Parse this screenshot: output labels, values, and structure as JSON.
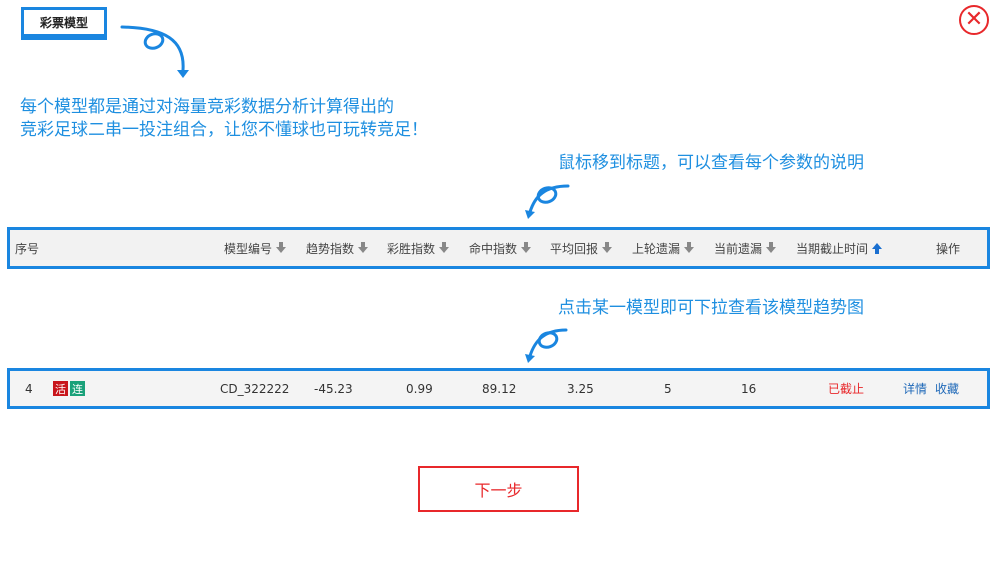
{
  "tag": {
    "label": "彩票模型"
  },
  "hints": {
    "intro_line1": "每个模型都是通过对海量竞彩数据分析计算得出的",
    "intro_line2": "竞彩足球二串一投注组合，让您不懂球也可玩转竞足！",
    "header_tip": "鼠标移到标题，可以查看每个参数的说明",
    "row_tip": "点击某一模型即可下拉查看该模型趋势图"
  },
  "table": {
    "headers": {
      "index": "序号",
      "model_no": "模型编号",
      "trend": "趋势指数",
      "win": "彩胜指数",
      "hit": "命中指数",
      "avg_return": "平均回报",
      "last_miss": "上轮遗漏",
      "cur_miss": "当前遗漏",
      "deadline": "当期截止时间",
      "action": "操作"
    },
    "row": {
      "index": "4",
      "badge_live": "活",
      "badge_streak": "连",
      "model_no": "CD_322222",
      "trend": "-45.23",
      "win": "0.99",
      "hit": "89.12",
      "avg_return": "3.25",
      "last_miss": "5",
      "cur_miss": "16",
      "status": "已截止",
      "detail": "详情",
      "favorite": "收藏"
    }
  },
  "next_button": {
    "label": "下一步"
  },
  "colors": {
    "accent": "#1a86e0",
    "danger": "#e8282b",
    "hint": "#1e8fe0"
  },
  "icons": [
    "close-icon",
    "sort-down-icon",
    "sort-up-icon",
    "curved-arrow-icon"
  ]
}
